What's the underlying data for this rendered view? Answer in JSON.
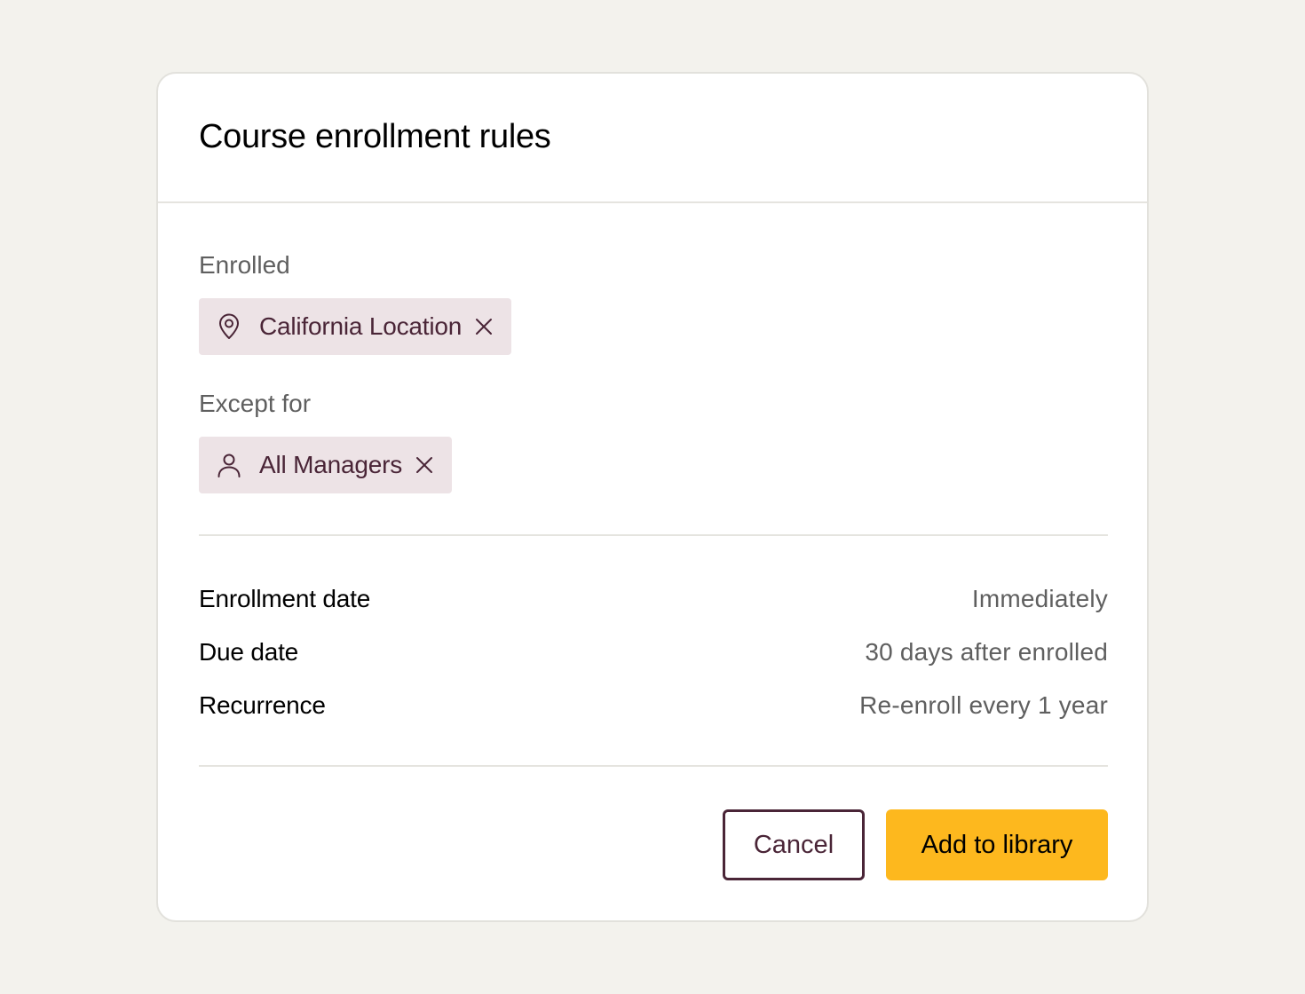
{
  "dialog": {
    "title": "Course enrollment rules",
    "enrolled": {
      "label": "Enrolled",
      "chip": {
        "icon": "location-pin-icon",
        "label": "California Location"
      }
    },
    "except": {
      "label": "Except for",
      "chip": {
        "icon": "person-icon",
        "label": "All Managers"
      }
    },
    "details": [
      {
        "key": "Enrollment date",
        "value": "Immediately"
      },
      {
        "key": "Due date",
        "value": "30 days after enrolled"
      },
      {
        "key": "Recurrence",
        "value": "Re-enroll every 1 year"
      }
    ],
    "actions": {
      "cancel_label": "Cancel",
      "primary_label": "Add to library"
    }
  },
  "colors": {
    "background": "#f3f2ed",
    "chip_bg": "#ede3e6",
    "chip_text": "#4a2537",
    "primary": "#fdb81e",
    "secondary_border": "#4a2537"
  }
}
